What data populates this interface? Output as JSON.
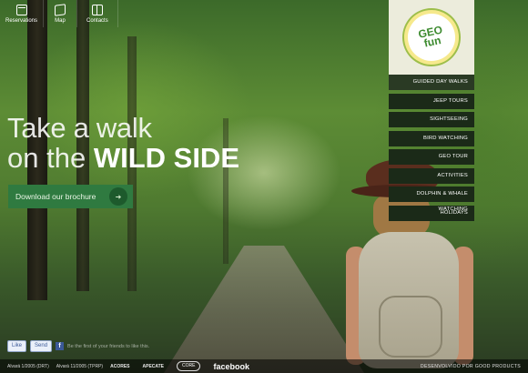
{
  "nav": [
    {
      "label": "Reservations",
      "icon": "calendar-icon"
    },
    {
      "label": "Map",
      "icon": "map-icon"
    },
    {
      "label": "Contacts",
      "icon": "contact-book-icon"
    }
  ],
  "hero": {
    "line1": "Take a walk",
    "line2_prefix": "on the",
    "line2_bold": "WILD SIDE"
  },
  "download_button": {
    "label": "Download our brochure",
    "icon": "arrow-circle-icon"
  },
  "logo": {
    "line1": "GEO",
    "line2": "fun"
  },
  "menu": [
    "GUIDED DAY WALKS",
    "JEEP TOURS",
    "SIGHTSEEING",
    "BIRD WATCHING",
    "GEO TOUR",
    "ACTIVITIES",
    "DOLPHIN & WHALE WATCHING",
    "HOLIDAYS"
  ],
  "social": {
    "like": "Like",
    "send": "Send",
    "text": "Be the first of your friends to like this."
  },
  "footer": {
    "reg1": "Alvará 1/2005 (DRT)",
    "reg2": "Alvará 11/2005 (TPRP)",
    "logos": [
      "ACORES",
      "APECATE",
      "CORE",
      "facebook"
    ],
    "credit": "DESENVOLVIDO POR GOOD PRODUCTS"
  },
  "colors": {
    "accent": "#2f7a40",
    "menu_bg": "#1b2a18",
    "logo_green": "#3c8a2e"
  }
}
